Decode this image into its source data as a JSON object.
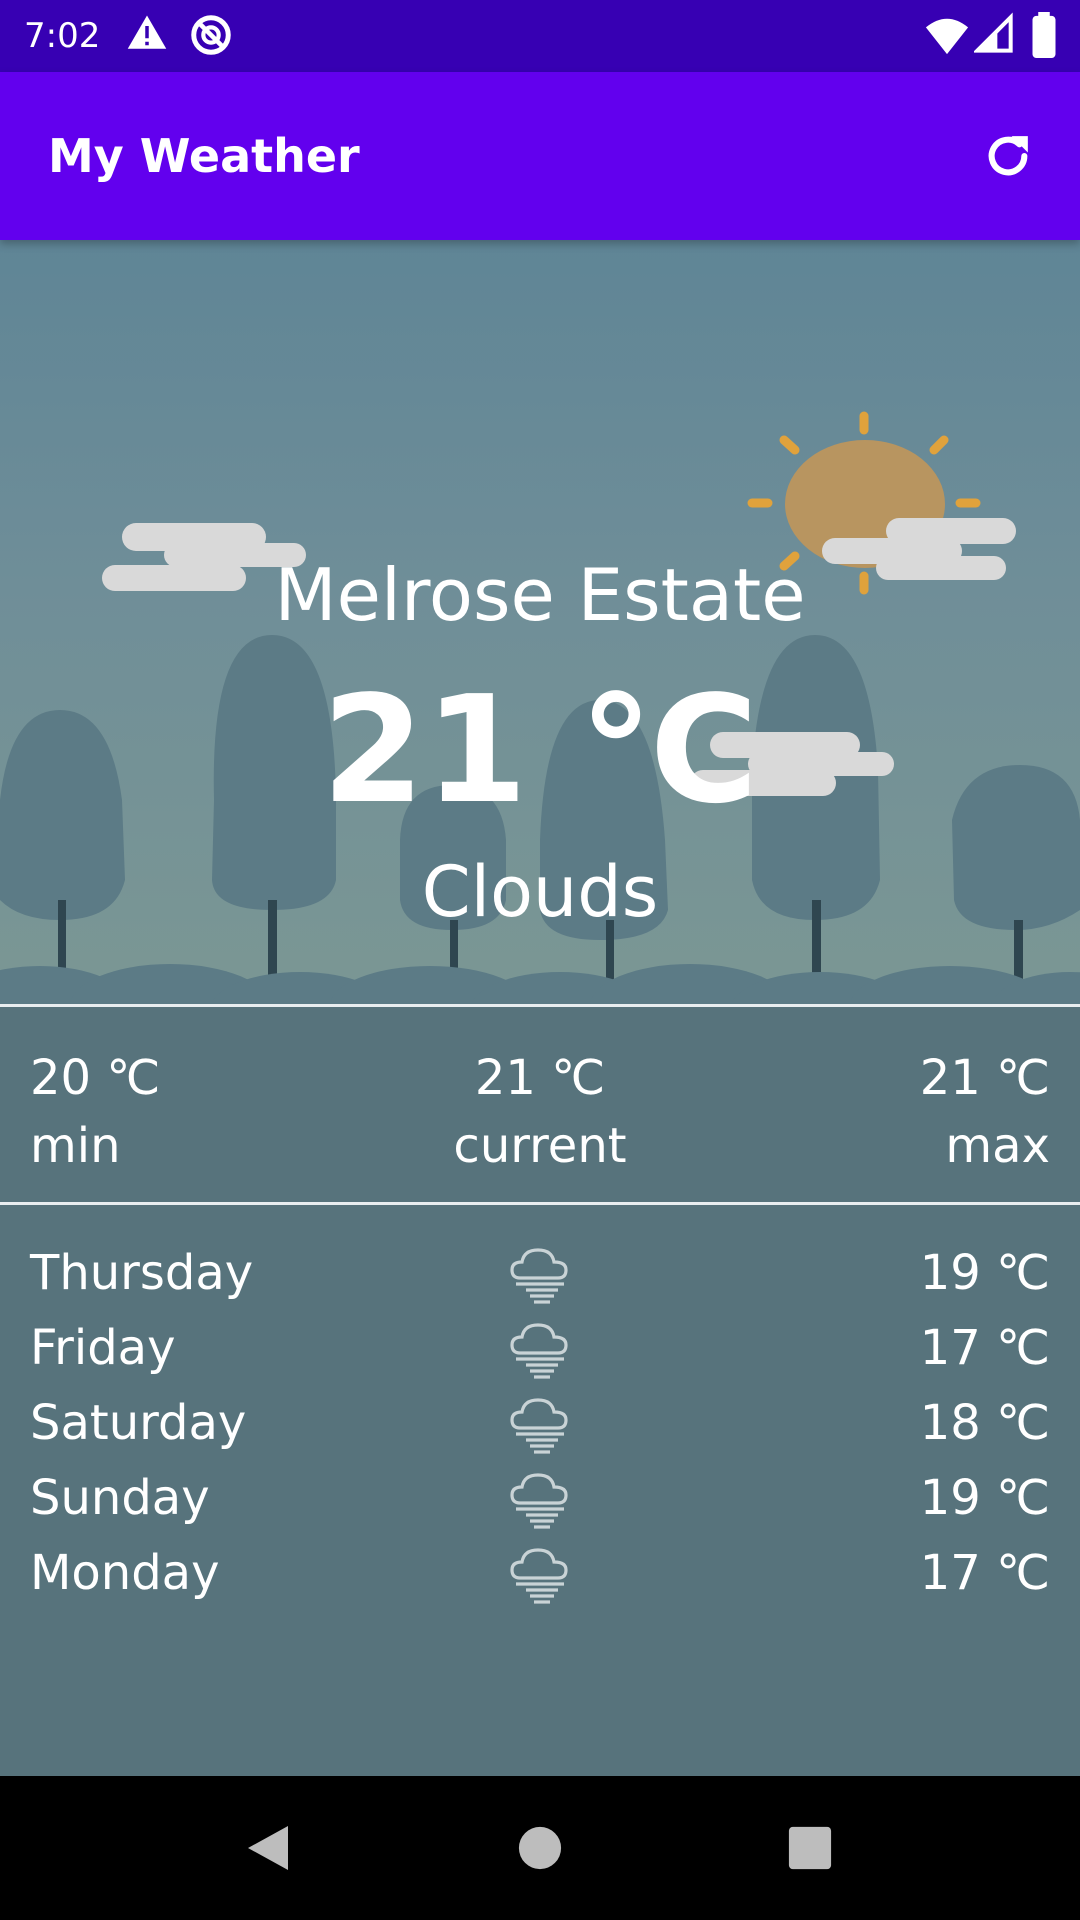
{
  "status_bar": {
    "time": "7:02",
    "icons": [
      "warning-icon",
      "do-not-disturb-icon",
      "wifi-icon",
      "signal-icon",
      "battery-icon"
    ]
  },
  "app_bar": {
    "title": "My Weather",
    "action_icon": "refresh-icon"
  },
  "weather": {
    "city": "Melrose Estate",
    "temperature": "21 ℃",
    "condition": "Clouds"
  },
  "summary": {
    "min_value": "20 ℃",
    "min_label": "min",
    "current_value": "21 ℃",
    "current_label": "current",
    "max_value": "21 ℃",
    "max_label": "max"
  },
  "forecast": [
    {
      "day": "Thursday",
      "icon": "rain-cloud-icon",
      "temp": "19 ℃"
    },
    {
      "day": "Friday",
      "icon": "rain-cloud-icon",
      "temp": "17 ℃"
    },
    {
      "day": "Saturday",
      "icon": "rain-cloud-icon",
      "temp": "18 ℃"
    },
    {
      "day": "Sunday",
      "icon": "rain-cloud-icon",
      "temp": "19 ℃"
    },
    {
      "day": "Monday",
      "icon": "rain-cloud-icon",
      "temp": "17 ℃"
    }
  ],
  "colors": {
    "status_bar": "#3700b3",
    "app_bar": "#6200ee",
    "panel": "#57737c",
    "sun": "#b89560",
    "sun_rays": "#e0a23c"
  },
  "nav_bar": {
    "icons": [
      "back-icon",
      "home-icon",
      "recents-icon"
    ]
  }
}
